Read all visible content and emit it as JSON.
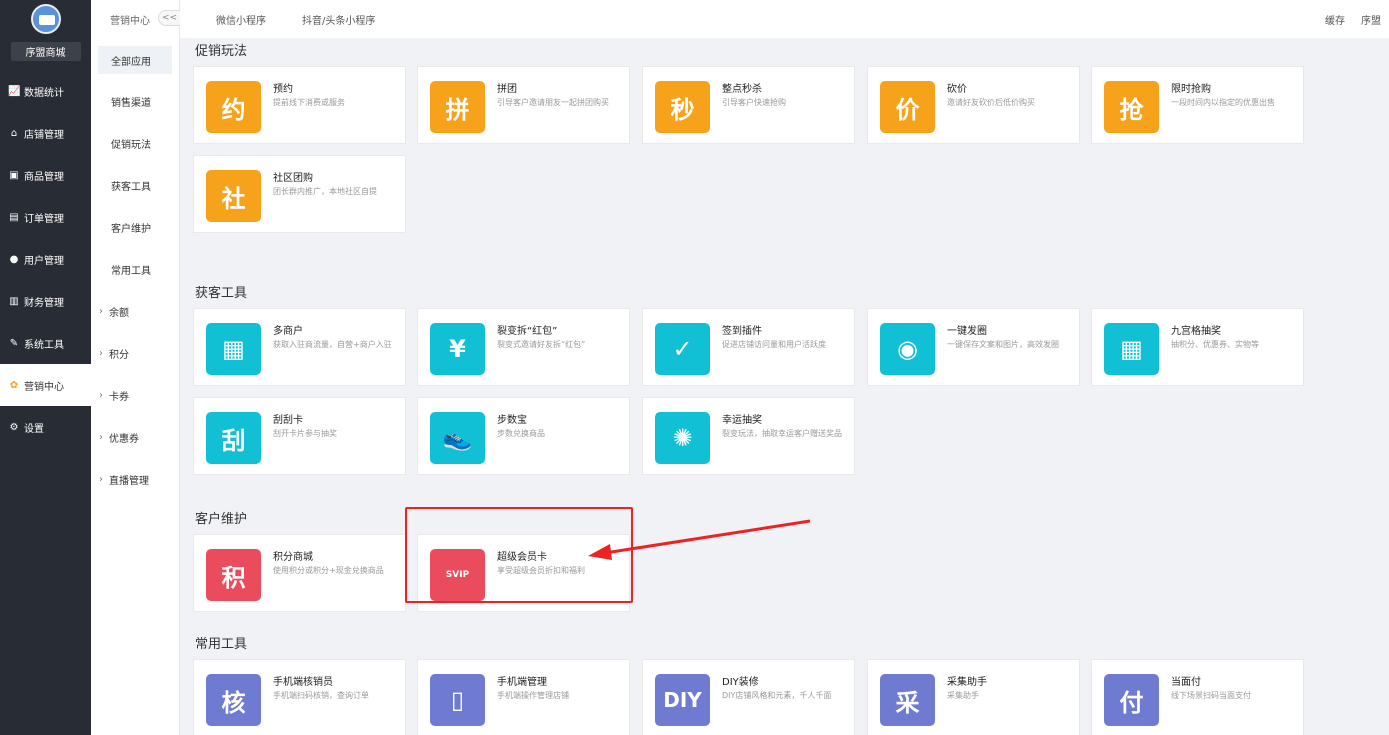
{
  "sidebar": {
    "shop_name": "序盟商城",
    "items": [
      {
        "label": "数据统计",
        "icon": "chart-line-icon"
      },
      {
        "label": "店铺管理",
        "icon": "shop-icon"
      },
      {
        "label": "商品管理",
        "icon": "goods-icon"
      },
      {
        "label": "订单管理",
        "icon": "order-icon"
      },
      {
        "label": "用户管理",
        "icon": "user-icon"
      },
      {
        "label": "财务管理",
        "icon": "finance-icon"
      },
      {
        "label": "系统工具",
        "icon": "wrench-icon"
      },
      {
        "label": "营销中心",
        "icon": "marketing-icon",
        "active": true
      },
      {
        "label": "设置",
        "icon": "settings-icon"
      }
    ]
  },
  "subnav": {
    "title": "营销中心",
    "collapse": "<<",
    "items": [
      {
        "label": "全部应用",
        "selected": true
      },
      {
        "label": "销售渠道"
      },
      {
        "label": "促销玩法"
      },
      {
        "label": "获客工具"
      },
      {
        "label": "客户维护"
      },
      {
        "label": "常用工具"
      },
      {
        "label": "余额",
        "expandable": true
      },
      {
        "label": "积分",
        "expandable": true
      },
      {
        "label": "卡券",
        "expandable": true
      },
      {
        "label": "优惠券",
        "expandable": true
      },
      {
        "label": "直播管理",
        "expandable": true
      }
    ]
  },
  "topbar": {
    "tabs": [
      "微信小程序",
      "抖音/头条小程序"
    ],
    "cache": "缓存",
    "user": "序盟"
  },
  "sections": [
    {
      "title": "促销玩法",
      "cards": [
        {
          "name": "预约",
          "desc": "提前线下消费或服务",
          "glyph": "约",
          "color": "orange",
          "icon": "reservation-icon"
        },
        {
          "name": "拼团",
          "desc": "引导客户邀请朋友一起拼团购买",
          "glyph": "拼",
          "color": "orange",
          "icon": "group-buy-icon"
        },
        {
          "name": "整点秒杀",
          "desc": "引导客户快速抢购",
          "glyph": "秒",
          "color": "orange",
          "icon": "flash-sale-icon"
        },
        {
          "name": "砍价",
          "desc": "邀请好友砍价后低价购买",
          "glyph": "价",
          "color": "orange",
          "icon": "bargain-icon"
        },
        {
          "name": "限时抢购",
          "desc": "一段时间内以指定的优惠出售",
          "glyph": "抢",
          "color": "orange",
          "icon": "timed-rush-icon"
        },
        {
          "name": "社区团购",
          "desc": "团长群内推广，本地社区自提",
          "glyph": "社",
          "color": "orange",
          "icon": "community-buy-icon"
        }
      ]
    },
    {
      "title": "获客工具",
      "cards": [
        {
          "name": "多商户",
          "desc": "获取入驻商流量，自营+商户入驻",
          "glyph": "▦",
          "color": "teal",
          "icon": "multi-merchant-icon"
        },
        {
          "name": "裂变拆“红包”",
          "desc": "裂变式邀请好友拆“红包”",
          "glyph": "¥",
          "color": "teal",
          "icon": "red-packet-icon"
        },
        {
          "name": "签到插件",
          "desc": "促进店铺访问量和用户活跃度",
          "glyph": "✓",
          "color": "teal",
          "icon": "check-in-icon"
        },
        {
          "name": "一键发圈",
          "desc": "一键保存文案和图片，高效发圈",
          "glyph": "◉",
          "color": "teal",
          "icon": "share-moments-icon"
        },
        {
          "name": "九宫格抽奖",
          "desc": "抽积分、优惠券、实物等",
          "glyph": "▦",
          "color": "teal",
          "icon": "grid-lottery-icon"
        },
        {
          "name": "刮刮卡",
          "desc": "刮开卡片参与抽奖",
          "glyph": "刮",
          "color": "teal",
          "icon": "scratch-card-icon"
        },
        {
          "name": "步数宝",
          "desc": "步数兑换商品",
          "glyph": "👟",
          "color": "teal",
          "icon": "step-treasure-icon"
        },
        {
          "name": "幸运抽奖",
          "desc": "裂变玩法，抽取幸运客户赠送奖品",
          "glyph": "✺",
          "color": "teal",
          "icon": "lucky-draw-icon"
        }
      ]
    },
    {
      "title": "客户维护",
      "cards": [
        {
          "name": "积分商城",
          "desc": "使用积分或积分+现金兑换商品",
          "glyph": "积",
          "color": "red",
          "icon": "points-mall-icon"
        },
        {
          "name": "超级会员卡",
          "desc": "享受超级会员折扣和福利",
          "glyph": "SVIP",
          "color": "red",
          "icon": "svip-card-icon"
        }
      ]
    },
    {
      "title": "常用工具",
      "cards": [
        {
          "name": "手机端核销员",
          "desc": "手机端扫码核销，查询订单",
          "glyph": "核",
          "color": "purple",
          "icon": "verifier-icon"
        },
        {
          "name": "手机端管理",
          "desc": "手机端操作管理店铺",
          "glyph": "▯",
          "color": "purple",
          "icon": "mobile-manage-icon"
        },
        {
          "name": "DIY装修",
          "desc": "DIY店铺风格和元素，千人千面",
          "glyph": "DIY",
          "color": "purple",
          "icon": "diy-icon"
        },
        {
          "name": "采集助手",
          "desc": "采集助手",
          "glyph": "采",
          "color": "purple",
          "icon": "collect-icon"
        },
        {
          "name": "当面付",
          "desc": "线下场景扫码当面支付",
          "glyph": "付",
          "color": "purple",
          "icon": "face-pay-icon"
        }
      ]
    }
  ]
}
